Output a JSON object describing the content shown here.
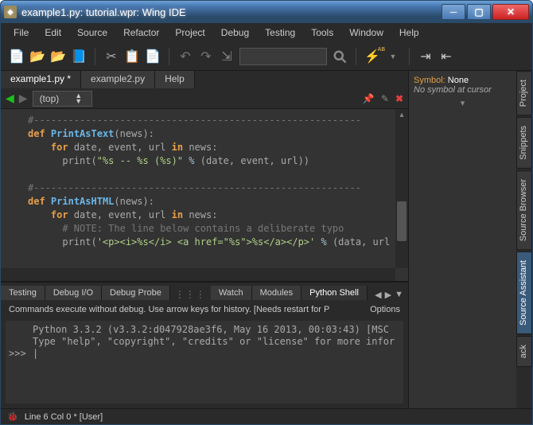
{
  "window": {
    "title": "example1.py: tutorial.wpr: Wing IDE"
  },
  "menu": [
    "File",
    "Edit",
    "Source",
    "Refactor",
    "Project",
    "Debug",
    "Testing",
    "Tools",
    "Window",
    "Help"
  ],
  "toolbar": {
    "search_placeholder": ""
  },
  "editor": {
    "tabs": [
      {
        "label": "example1.py *",
        "active": true
      },
      {
        "label": "example2.py",
        "active": false
      },
      {
        "label": "Help",
        "active": false
      }
    ],
    "scope": "(top)",
    "code_lines": [
      {
        "type": "comment",
        "text": "#---------------------------------------------------------"
      },
      {
        "type": "def",
        "kw": "def",
        "name": "PrintAsText",
        "args": "(news):"
      },
      {
        "type": "for",
        "indent": "    ",
        "kw": "for",
        "body": " date, event, url ",
        "in": "in",
        "rest": " news:"
      },
      {
        "type": "print",
        "indent": "      ",
        "call": "print(",
        "str": "\"%s -- %s (%s)\"",
        "op": " % ",
        "args": "(date, event, url))"
      },
      {
        "type": "blank",
        "text": ""
      },
      {
        "type": "comment",
        "text": "#---------------------------------------------------------"
      },
      {
        "type": "def",
        "kw": "def",
        "name": "PrintAsHTML",
        "args": "(news):"
      },
      {
        "type": "for",
        "indent": "    ",
        "kw": "for",
        "body": " date, event, url ",
        "in": "in",
        "rest": " news:"
      },
      {
        "type": "note",
        "indent": "      ",
        "text": "# NOTE: The line below contains a deliberate typo"
      },
      {
        "type": "print",
        "indent": "      ",
        "call": "print(",
        "str": "'<p><i>%s</i> <a href=\"%s\">%s</a></p>'",
        "op": " % ",
        "args": "(data, url"
      }
    ]
  },
  "bottom": {
    "tabs": [
      "Testing",
      "Debug I/O",
      "Debug Probe",
      "Watch",
      "Modules",
      "Python Shell"
    ],
    "active_tab": "Python Shell",
    "info_left": "Commands execute without debug.  Use arrow keys for history.  [Needs restart for P",
    "info_right": "Options",
    "console_lines": [
      "Python 3.3.2 (v3.3.2:d047928ae3f6, May 16 2013, 00:03:43) [MSC ",
      "Type \"help\", \"copyright\", \"credits\" or \"license\" for more infor"
    ],
    "prompt": ">>>",
    "input": "|"
  },
  "right": {
    "symbol_label": "Symbol: ",
    "symbol_value": "None",
    "symbol_sub": "No symbol at cursor",
    "tabs": [
      "Project",
      "Snippets",
      "Source Browser",
      "Source Assistant",
      "ack"
    ],
    "active_tab": "Source Assistant"
  },
  "status": {
    "text": "Line 6 Col 0 * [User]"
  }
}
